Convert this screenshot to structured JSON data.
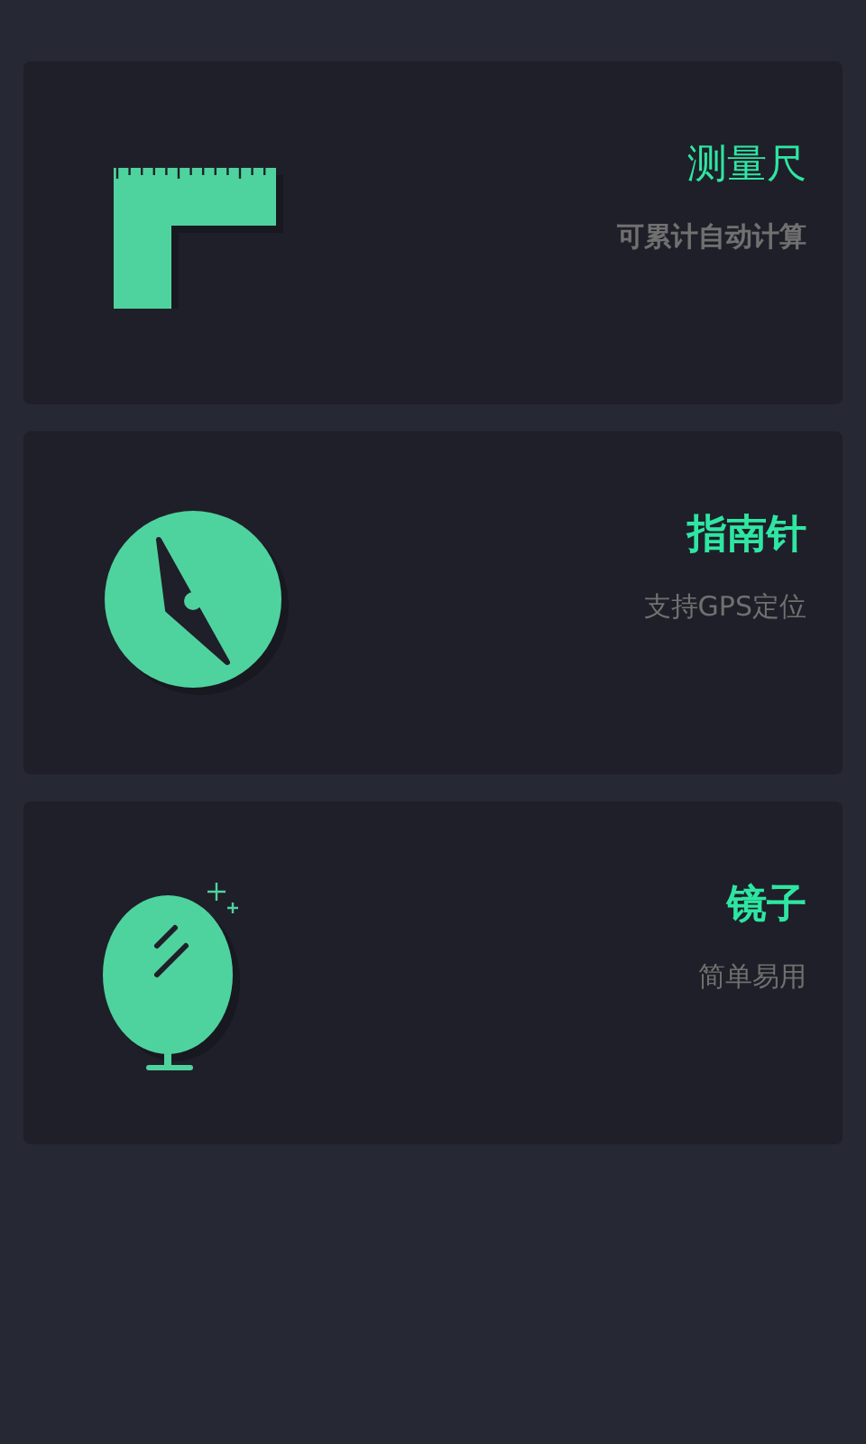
{
  "cards": [
    {
      "kind": "ruler",
      "title": "测量尺",
      "subtitle": "可累计自动计算",
      "title_bold": false,
      "subtitle_bold": true
    },
    {
      "kind": "compass",
      "title": "指南针",
      "subtitle": "支持GPS定位",
      "title_bold": true,
      "subtitle_bold": false
    },
    {
      "kind": "mirror",
      "title": "镜子",
      "subtitle": "简单易用",
      "title_bold": true,
      "subtitle_bold": false
    }
  ]
}
